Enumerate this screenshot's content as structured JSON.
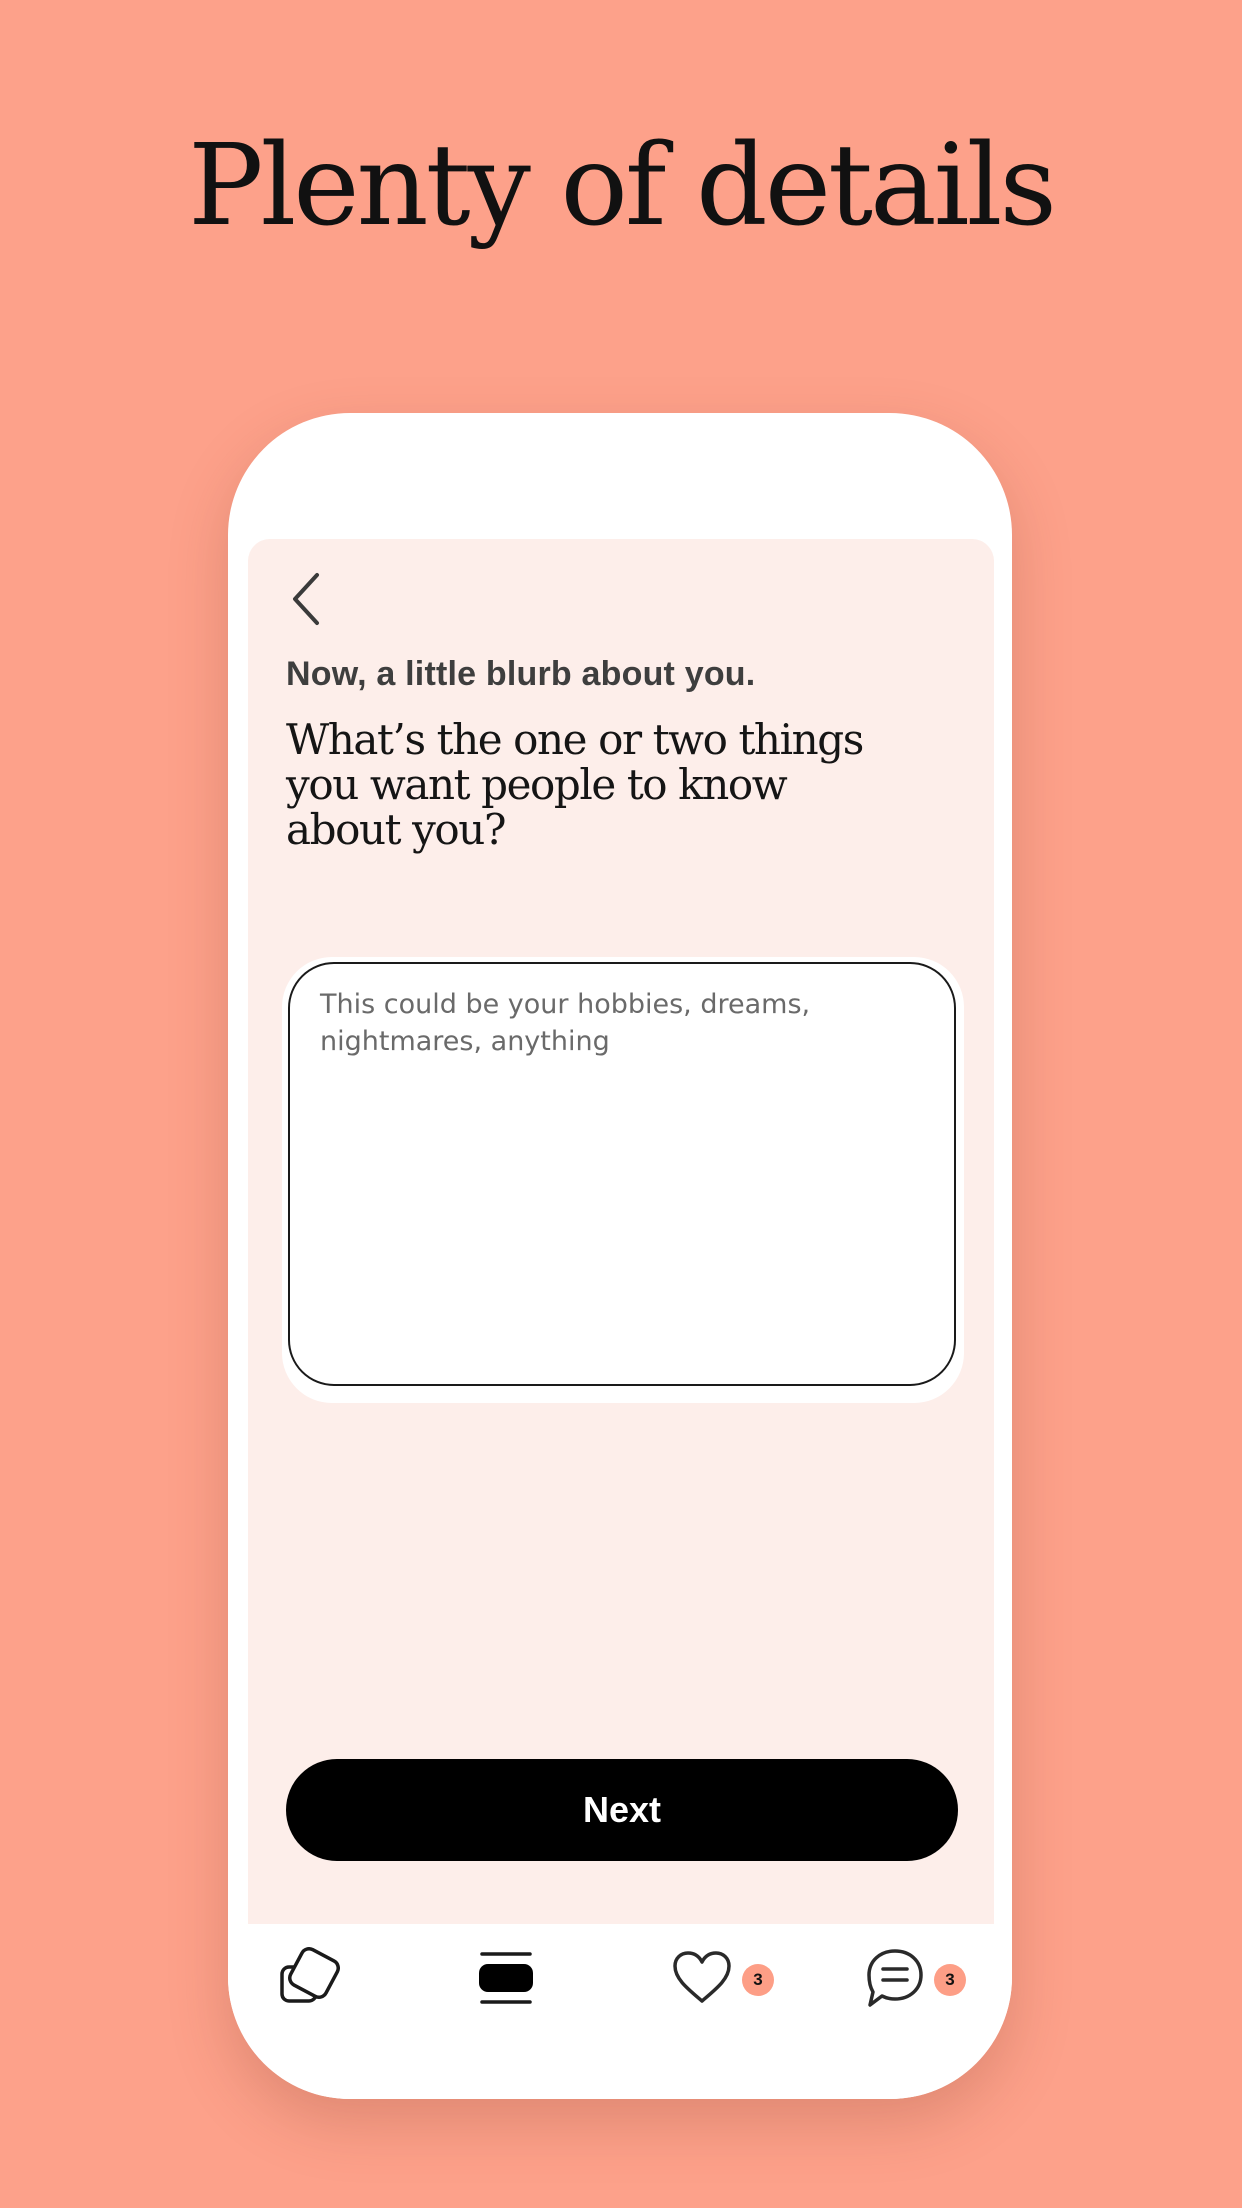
{
  "headline": "Plenty of details",
  "colors": {
    "background": "#fda18a",
    "screen": "#fdeeea",
    "button": "#000000",
    "badge": "#fd9e86"
  },
  "prompt": {
    "eyebrow": "Now, a little blurb about you.",
    "question": "What’s the one or two things you want people to know about you?",
    "input_placeholder": "This could be your hobbies, dreams, nightmares, anything",
    "input_value": ""
  },
  "next_button": {
    "label": "Next"
  },
  "tabbar": {
    "items": [
      {
        "name": "discover",
        "icon": "discover-cards-icon"
      },
      {
        "name": "standouts",
        "icon": "standouts-icon"
      },
      {
        "name": "likes",
        "icon": "heart-icon",
        "badge": "3"
      },
      {
        "name": "matches",
        "icon": "chat-bubble-icon",
        "badge": "3"
      }
    ]
  }
}
